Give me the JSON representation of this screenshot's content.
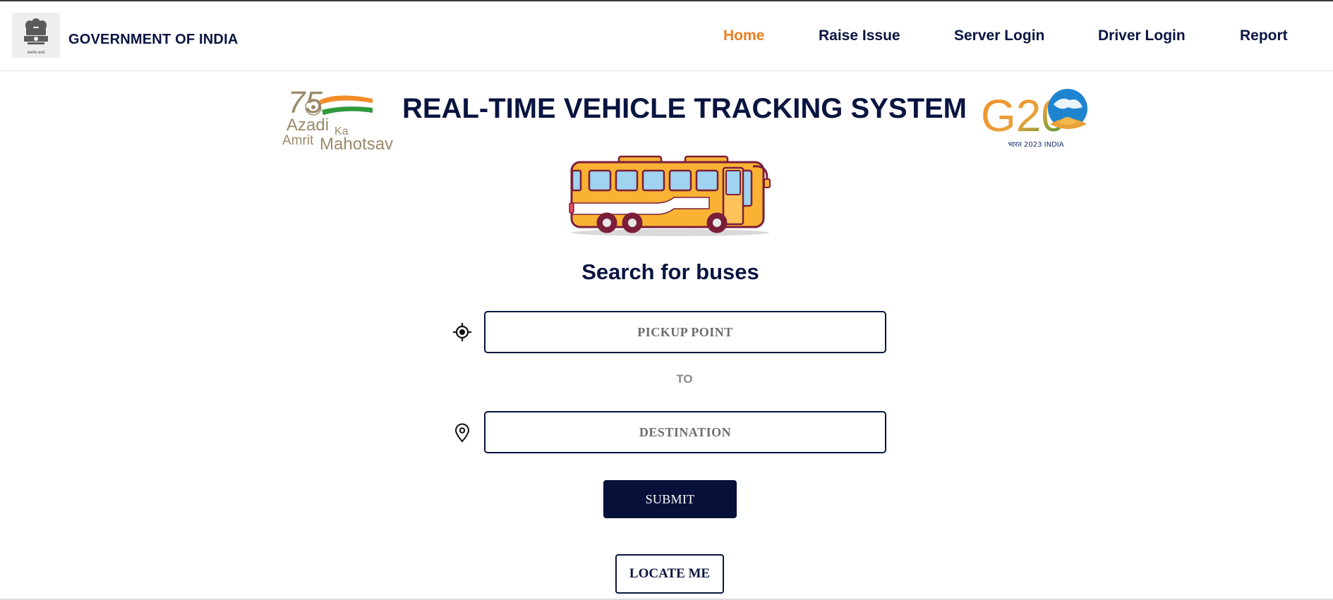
{
  "header": {
    "brand": "GOVERNMENT OF INDIA",
    "emblem_caption": "सत्यमेव जयते",
    "nav": [
      {
        "label": "Home",
        "active": true
      },
      {
        "label": "Raise Issue",
        "active": false
      },
      {
        "label": "Server Login",
        "active": false
      },
      {
        "label": "Driver Login",
        "active": false
      },
      {
        "label": "Report",
        "active": false
      }
    ]
  },
  "banner": {
    "title": "REAL-TIME VEHICLE TRACKING SYSTEM",
    "left_logo": {
      "number": "75",
      "line1": "Azadi",
      "ka": "Ka",
      "line2": "Amrit",
      "line3": "Mahotsav"
    },
    "right_logo": {
      "mark": "G20",
      "caption": "भारत 2023 INDIA"
    }
  },
  "search": {
    "title": "Search for buses",
    "pickup_placeholder": "PICKUP POINT",
    "pickup_value": "",
    "to_label": "TO",
    "destination_placeholder": "DESTINATION",
    "destination_value": "",
    "submit_label": "SUBMIT",
    "locate_label": "LOCATE ME"
  },
  "icons": {
    "pickup": "crosshair-location-icon",
    "destination": "map-pin-icon",
    "vehicle": "bus-icon",
    "emblem": "national-emblem-icon"
  },
  "colors": {
    "navy": "#0a1440",
    "accent_orange": "#f07e1e",
    "submit_bg": "#071038",
    "bus_yellow": "#f9b233"
  }
}
